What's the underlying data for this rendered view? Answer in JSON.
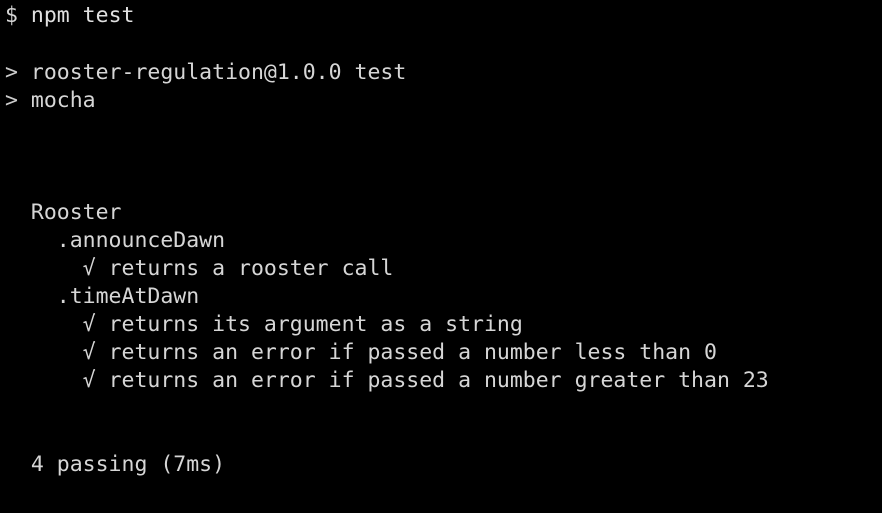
{
  "terminal": {
    "prompt_symbol": "$",
    "command": "npm test",
    "script_marker_1": ">",
    "script_line_1": "rooster-regulation@1.0.0 test",
    "script_marker_2": ">",
    "script_line_2": "mocha",
    "suite": "Rooster",
    "groups": [
      {
        "title": ".announceDawn",
        "tests": [
          {
            "check": "√",
            "text": "returns a rooster call"
          }
        ]
      },
      {
        "title": ".timeAtDawn",
        "tests": [
          {
            "check": "√",
            "text": "returns its argument as a string"
          },
          {
            "check": "√",
            "text": "returns an error if passed a number less than 0"
          },
          {
            "check": "√",
            "text": "returns an error if passed a number greater than 23"
          }
        ]
      }
    ],
    "summary": "4 passing (7ms)"
  },
  "colors": {
    "background": "#000000",
    "text": "#d6d6d6"
  }
}
